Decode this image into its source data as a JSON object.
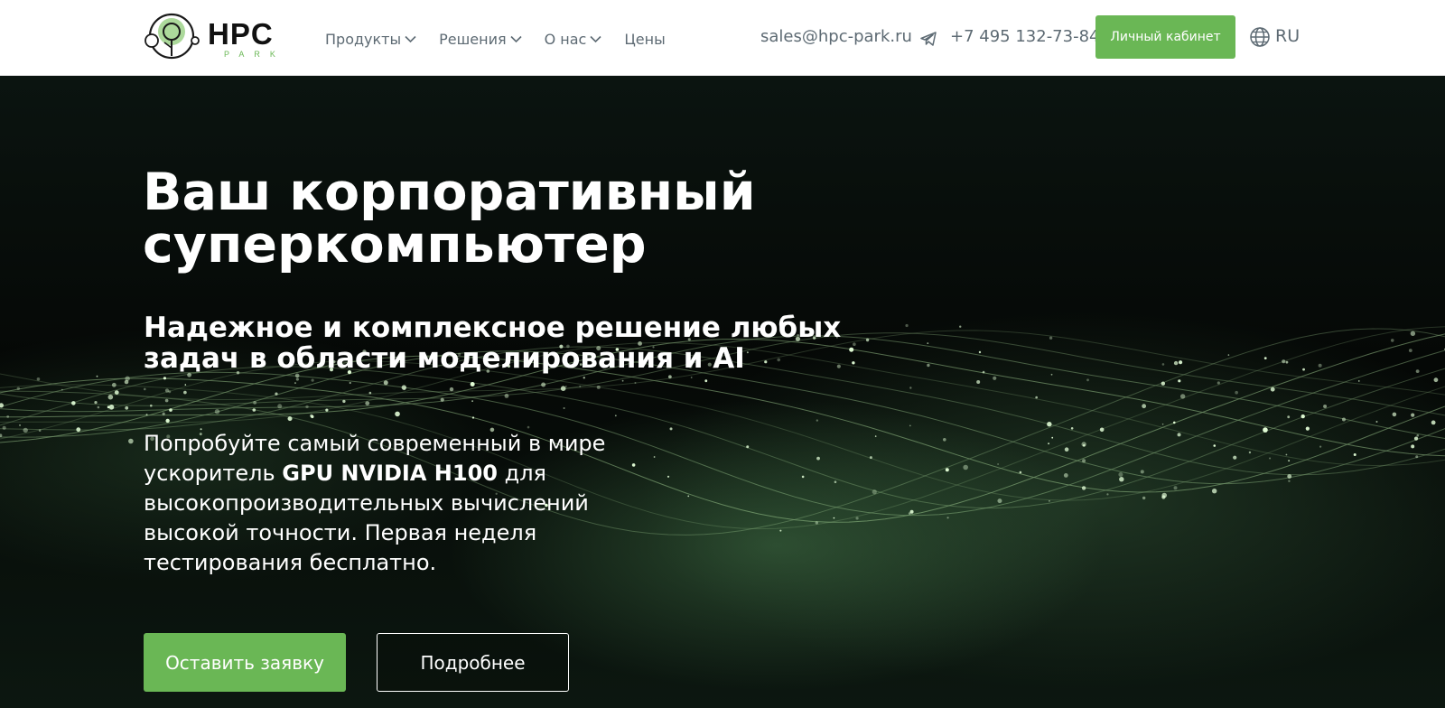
{
  "header": {
    "logo": {
      "text": "HPC",
      "subtext": "PARK",
      "brand_color": "#6ab755",
      "icon": "tree-in-circle-logo"
    },
    "nav": [
      {
        "label": "Продукты",
        "has_dropdown": true
      },
      {
        "label": "Решения",
        "has_dropdown": true
      },
      {
        "label": "О нас",
        "has_dropdown": true
      },
      {
        "label": "Цены",
        "has_dropdown": false
      }
    ],
    "email": "sales@hpc-park.ru",
    "telegram_icon": "telegram-icon",
    "phone": "+7 495 132-73-84",
    "cabinet_button": "Личный кабинет",
    "language_icon": "globe-icon",
    "language": "RU"
  },
  "hero": {
    "title_line1": "Ваш корпоративный",
    "title_line2": "суперкомпьютер",
    "subtitle": "Надежное и комплексное решение любых задач в области моделирования и AI",
    "text_before": "Попробуйте самый современный в мире ускоритель ",
    "text_bold": "GPU NVIDIA H100",
    "text_after": " для высокопроизводительных вычислений высокой точности. Первая неделя тестирования бесплатно.",
    "primary_button": "Оставить заявку",
    "secondary_button": "Подробнее",
    "accent_color": "#6ab755",
    "background": "dark with glowing green particle waves"
  }
}
